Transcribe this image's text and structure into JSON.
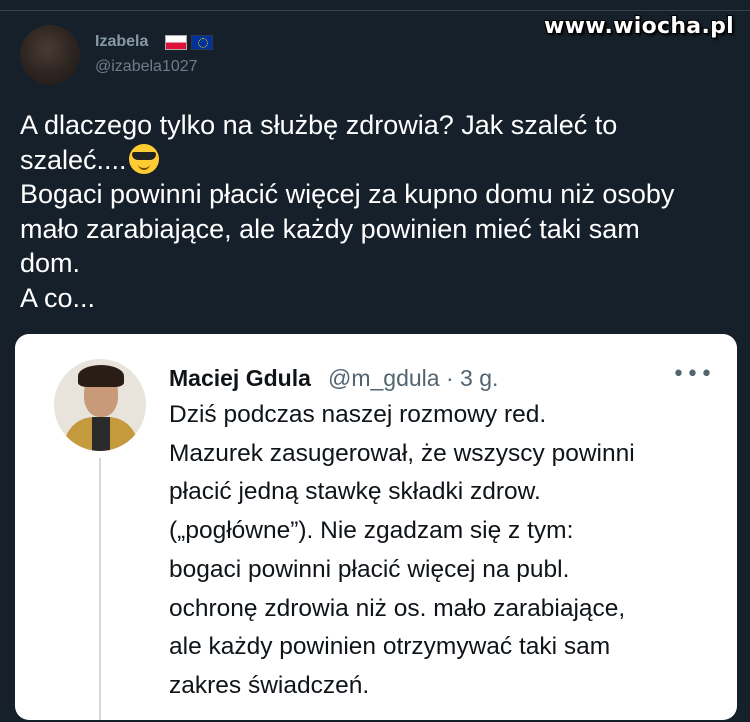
{
  "watermark": "www.wiocha.pl",
  "tweet": {
    "author_name": "Izabela",
    "author_flags": [
      "poland-flag-icon",
      "eu-flag-icon"
    ],
    "handle": "@izabela1027",
    "lines": [
      "A dlaczego tylko na służbę zdrowia? Jak szaleć to",
      "szaleć....",
      "Bogaci powinni płacić więcej za kupno domu niż osoby",
      "mało zarabiające, ale każdy powinien mieć taki sam",
      "dom.",
      "A co..."
    ],
    "emoji": "sunglasses-emoji-icon"
  },
  "quoted": {
    "name": "Maciej Gdula",
    "handle_time": "@m_gdula · 3 g.",
    "more_label": "•••",
    "lines": [
      "Dziś podczas naszej rozmowy red.",
      "Mazurek zasugerował, że wszyscy powinni",
      "płacić jedną stawkę składki zdrow.",
      "(„pogłówne”). Nie zgadzam się z tym:",
      "bogaci powinni płacić więcej na publ.",
      "ochronę zdrowia niż os. mało zarabiające,",
      "ale każdy powinien otrzymywać taki sam",
      "zakres świadczeń."
    ]
  },
  "colors": {
    "background": "#15202b",
    "text_primary": "#ffffff",
    "text_secondary": "#8899a6",
    "card_background": "#ffffff",
    "card_text": "#0f1419",
    "card_secondary": "#536471"
  }
}
